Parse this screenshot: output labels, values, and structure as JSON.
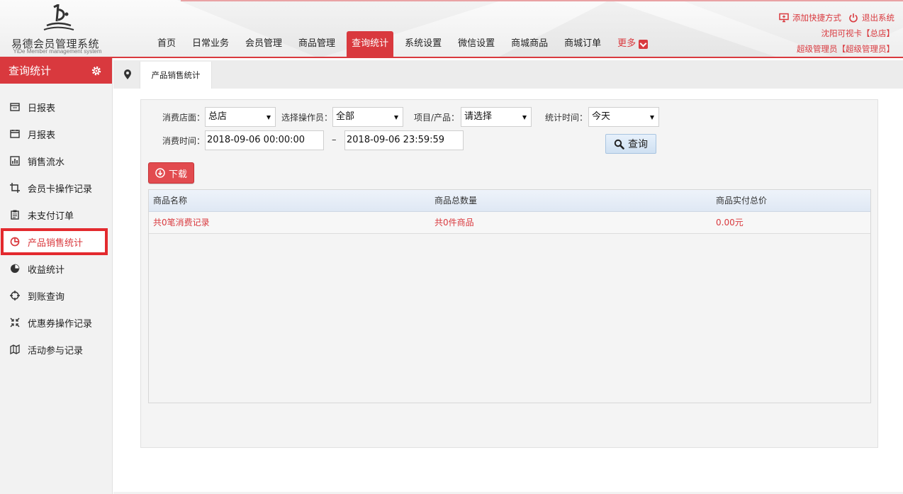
{
  "app": {
    "title": "易德会员管理系统",
    "subtitle": "YiDe Member management system"
  },
  "nav": {
    "items": [
      {
        "label": "首页",
        "active": false
      },
      {
        "label": "日常业务",
        "active": false
      },
      {
        "label": "会员管理",
        "active": false
      },
      {
        "label": "商品管理",
        "active": false
      },
      {
        "label": "查询统计",
        "active": true
      },
      {
        "label": "系统设置",
        "active": false
      },
      {
        "label": "微信设置",
        "active": false
      },
      {
        "label": "商城商品",
        "active": false
      },
      {
        "label": "商城订单",
        "active": false
      }
    ],
    "more_label": "更多"
  },
  "top_right": {
    "add_shortcut": "添加快捷方式",
    "logout": "退出系统",
    "store_line": "沈阳可视卡【总店】",
    "user_line": "超级管理员【超级管理员】"
  },
  "sidebar": {
    "title": "查询统计",
    "items": [
      {
        "label": "日报表",
        "icon": "calendar-icon"
      },
      {
        "label": "月报表",
        "icon": "calendar-month-icon"
      },
      {
        "label": "销售流水",
        "icon": "bar-chart-icon"
      },
      {
        "label": "会员卡操作记录",
        "icon": "crop-icon"
      },
      {
        "label": "未支付订单",
        "icon": "clipboard-icon"
      },
      {
        "label": "产品销售统计",
        "icon": "pie-chart-icon",
        "active": true
      },
      {
        "label": "收益统计",
        "icon": "pie-filled-icon"
      },
      {
        "label": "到账查询",
        "icon": "crosshair-icon"
      },
      {
        "label": "优惠券操作记录",
        "icon": "arrows-in-icon"
      },
      {
        "label": "活动参与记录",
        "icon": "map-icon"
      }
    ]
  },
  "tab": {
    "label": "产品销售统计"
  },
  "filters": {
    "store_label": "消费店面：",
    "store_value": "总店",
    "operator_label": "选择操作员：",
    "operator_value": "全部",
    "item_label": "项目/产品：",
    "item_value": "请选择",
    "period_label": "统计时间：",
    "period_value": "今天",
    "time_label": "消费时间：",
    "time_start": "2018-09-06 00:00:00",
    "time_sep": "–",
    "time_end": "2018-09-06 23:59:59",
    "query_label": "查询",
    "download_label": "下载"
  },
  "table": {
    "headers": [
      "商品名称",
      "商品总数量",
      "商品实付总价"
    ],
    "summary": [
      "共0笔消费记录",
      "共0件商品",
      "0.00元"
    ]
  },
  "colors": {
    "accent": "#d9393e",
    "highlight_border": "#e32a2e"
  }
}
